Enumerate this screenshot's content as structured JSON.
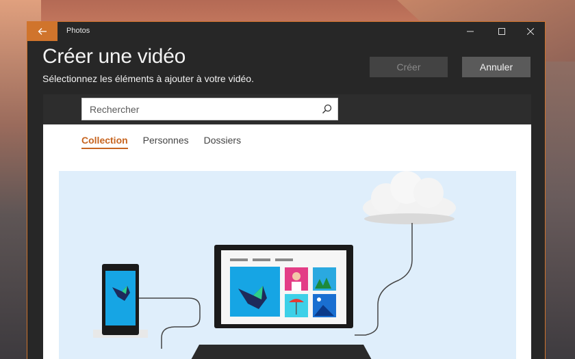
{
  "window": {
    "app_title": "Photos",
    "back_icon": "arrow-left-icon",
    "accent": "#d0742c"
  },
  "header": {
    "title": "Créer une vidéo",
    "subtitle": "Sélectionnez les éléments à ajouter à votre vidéo."
  },
  "actions": {
    "create_label": "Créer",
    "cancel_label": "Annuler"
  },
  "search": {
    "placeholder": "Rechercher",
    "value": ""
  },
  "tabs": [
    {
      "label": "Collection",
      "active": true
    },
    {
      "label": "Personnes",
      "active": false
    },
    {
      "label": "Dossiers",
      "active": false
    }
  ],
  "colors": {
    "active_tab": "#c7641f",
    "illustration_bg": "#dfeefb",
    "title_bar": "#272727"
  }
}
